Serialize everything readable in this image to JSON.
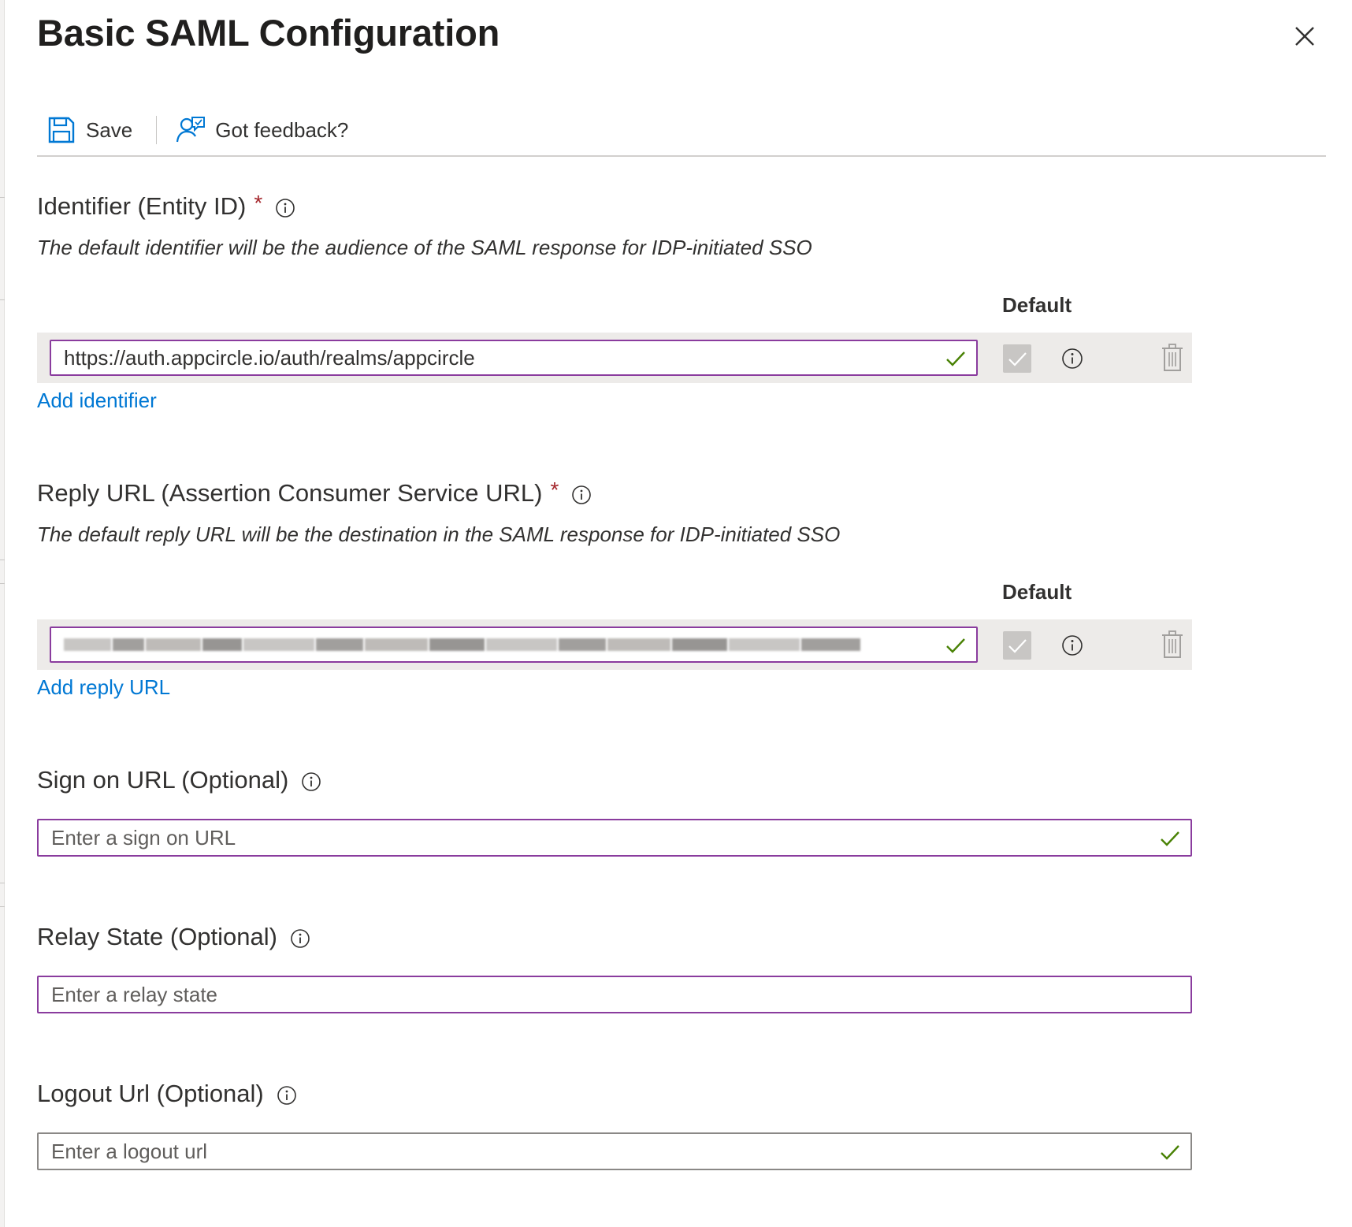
{
  "panel": {
    "title": "Basic SAML Configuration",
    "close_icon": "close-icon"
  },
  "toolbar": {
    "save_label": "Save",
    "save_icon": "save-icon",
    "feedback_label": "Got feedback?",
    "feedback_icon": "feedback-icon"
  },
  "identifier": {
    "title": "Identifier (Entity ID)",
    "required": "*",
    "description": "The default identifier will be the audience of the SAML response for IDP-initiated SSO",
    "default_header": "Default",
    "value": "https://auth.appcircle.io/auth/realms/appcircle",
    "add_link": "Add identifier"
  },
  "reply_url": {
    "title": "Reply URL (Assertion Consumer Service URL)",
    "required": "*",
    "description": "The default reply URL will be the destination in the SAML response for IDP-initiated SSO",
    "default_header": "Default",
    "add_link": "Add reply URL"
  },
  "sign_on": {
    "title": "Sign on URL (Optional)",
    "placeholder": "Enter a sign on URL"
  },
  "relay_state": {
    "title": "Relay State (Optional)",
    "placeholder": "Enter a relay state"
  },
  "logout": {
    "title": "Logout Url (Optional)",
    "placeholder": "Enter a logout url"
  },
  "colors": {
    "accent_link": "#0078d4",
    "input_border_active": "#8a3c9e",
    "check_green": "#498205",
    "required_red": "#a4262c"
  }
}
